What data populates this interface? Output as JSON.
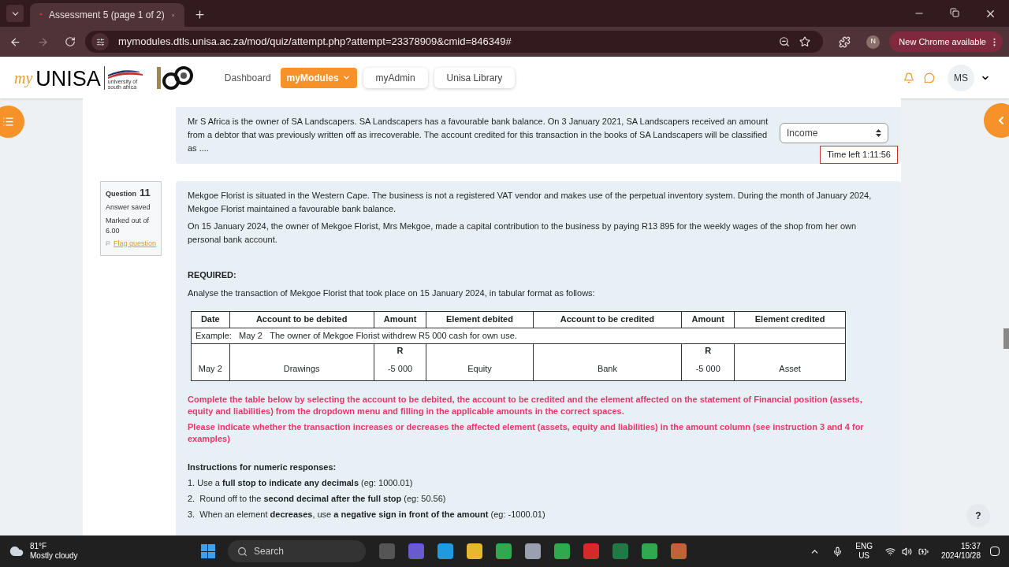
{
  "browser": {
    "tab_title": "Assessment 5 (page 1 of 2)",
    "url": "mymodules.dtls.unisa.ac.za/mod/quiz/attempt.php?attempt=23378909&cmid=846349#",
    "profile": "N",
    "update_label": "New Chrome available"
  },
  "site": {
    "logo_my": "my",
    "logo_unisa": "UNISA",
    "logo_sub": "university of south africa",
    "nav": [
      {
        "label": "Dashboard",
        "kind": "link",
        "selected": false
      },
      {
        "label": "myModules",
        "kind": "dropdown",
        "selected": true
      },
      {
        "label": "myAdmin",
        "kind": "pill",
        "selected": false
      },
      {
        "label": "Unisa Library",
        "kind": "pill",
        "selected": false
      }
    ],
    "user": "MS"
  },
  "prev_question": {
    "text": "Mr S Africa is the owner of SA Landscapers. SA Landscapers has a favourable bank balance. On 3 January 2021, SA Landscapers received an amount from a debtor that was previously written off as irrecoverable. The account credited for this transaction in the books of SA Landscapers will be classified as ....",
    "answer": "Income"
  },
  "timer": "Time left 1:11:56",
  "question": {
    "label": "Question",
    "number": "11",
    "status": "Answer saved",
    "marks": "Marked out of 6.00",
    "flag": "Flag question",
    "paragraphs": [
      "Mekgoe Florist is situated in the Western Cape. The business is not a registered VAT vendor and makes use of the perpetual inventory system. During the month of January 2024, Mekgoe Florist maintained a favourable bank balance.",
      "On 15 January 2024, the owner of Mekgoe Florist, Mrs Mekgoe, made a capital contribution to the business by paying R13 895 for the weekly wages of the shop from her own personal bank account."
    ],
    "required": "REQUIRED:",
    "task": "Analyse the transaction of Mekgoe Florist that took place on 15 January 2024, in tabular format as follows:",
    "table": {
      "columns": [
        "Date",
        "Account to be debited",
        "Amount",
        "Element debited",
        "Account to be credited",
        "Amount",
        "Element credited"
      ],
      "example_label": "Example:   May 2",
      "example_text": "The owner of Mekgoe Florist withdrew R5 000 cash for own use.",
      "row": [
        {
          "text": "May 2"
        },
        {
          "text": "Drawings"
        },
        {
          "label": "R",
          "text": "-5 000"
        },
        {
          "text": "Equity"
        },
        {
          "text": "Bank"
        },
        {
          "label": "R",
          "text": "-5 000"
        },
        {
          "text": "Asset"
        }
      ]
    },
    "notes": [
      "Complete the table below by selecting the account to be debited, the account to be credited and the element affected on the statement of Financial position (assets, equity and liabilities) from the dropdown menu and filling in the applicable amounts in the correct spaces.",
      "Please indicate whether the transaction increases or decreases the affected element (assets, equity and liabilities) in the amount column (see instruction 3 and 4 for examples)"
    ],
    "instructions_title": "Instructions for numeric responses:",
    "instructions": [
      "1. Use a **full stop to indicate any decimals** (eg: 1000.01)",
      "2.  Round off to the **second decimal after the full stop** (eg: 50.56)",
      "3.  When an element **decreases**, use **a negative sign in front of the amount** (eg: -1000.01)"
    ]
  },
  "help": "?",
  "taskbar": {
    "temp": "81°F",
    "weather": "Mostly cloudy",
    "search": "Search",
    "lang": "ENG",
    "region": "US",
    "time": "15:37",
    "date": "2024/10/28"
  }
}
